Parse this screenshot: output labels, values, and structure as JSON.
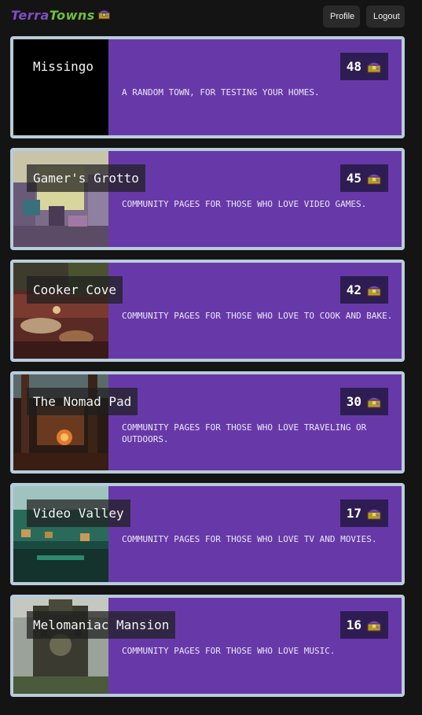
{
  "header": {
    "logo_part1": "Terra",
    "logo_part2": "Towns",
    "logo_icon": "treasure-chest-icon",
    "profile_label": "Profile",
    "logout_label": "Logout"
  },
  "towns": [
    {
      "name": "Missingo",
      "count": "48",
      "description": "A random town, for testing your homes.",
      "image": "blank-black"
    },
    {
      "name": "Gamer's Grotto",
      "count": "45",
      "description": "Community pages for those who love video games.",
      "image": "gaming-room-cave"
    },
    {
      "name": "Cooker Cove",
      "count": "42",
      "description": "Community pages for those who love to cook and bake.",
      "image": "cooking-cove"
    },
    {
      "name": "The Nomad Pad",
      "count": "30",
      "description": "Community pages for those who love traveling or outdoors.",
      "image": "campfire-forest"
    },
    {
      "name": "Video Valley",
      "count": "17",
      "description": "Community pages for those who love TV and movies.",
      "image": "tv-valley"
    },
    {
      "name": "Melomaniac Mansion",
      "count": "16",
      "description": "Community pages for those who love music.",
      "image": "music-mansion"
    }
  ],
  "colors": {
    "background": "#141414",
    "card": "#6739a8",
    "card_border": "#b9ccd9",
    "badge": "#2e1d52",
    "logo_purple": "#7d4fc4",
    "logo_green": "#6fbf3a"
  }
}
